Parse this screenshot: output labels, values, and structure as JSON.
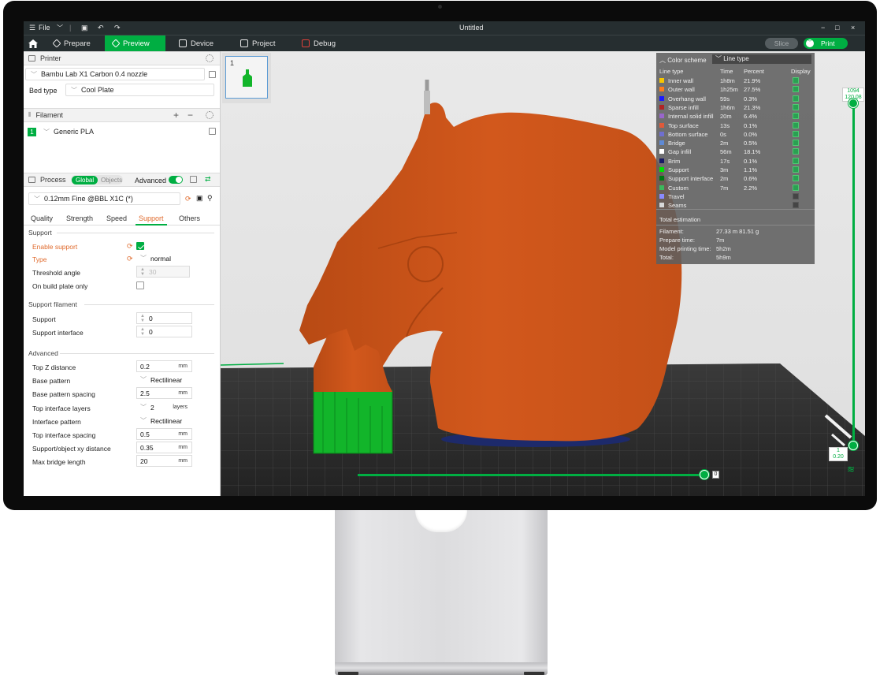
{
  "window": {
    "title": "Untitled",
    "file_menu": "File"
  },
  "tabs": [
    {
      "label": "Prepare"
    },
    {
      "label": "Preview"
    },
    {
      "label": "Device"
    },
    {
      "label": "Project"
    },
    {
      "label": "Debug"
    }
  ],
  "actions": {
    "slice": "Slice",
    "print": "Print"
  },
  "printer": {
    "header": "Printer",
    "preset": "Bambu Lab X1 Carbon 0.4 nozzle",
    "bed_type_label": "Bed type",
    "bed_type": "Cool Plate"
  },
  "filament": {
    "header": "Filament",
    "index": "1",
    "name": "Generic PLA",
    "plus": "+",
    "minus": "−"
  },
  "process": {
    "header": "Process",
    "mode_global": "Global",
    "mode_objects": "Objects",
    "advanced_label": "Advanced",
    "preset": "0.12mm Fine @BBL X1C (*)"
  },
  "subtabs": [
    "Quality",
    "Strength",
    "Speed",
    "Support",
    "Others"
  ],
  "support": {
    "group": "Support",
    "enable_support": "Enable support",
    "type_label": "Type",
    "type_value": "normal",
    "threshold_angle_label": "Threshold angle",
    "threshold_angle_value": "30",
    "build_plate_only": "On build plate only"
  },
  "support_filament": {
    "group": "Support filament",
    "support_label": "Support",
    "support_value": "0",
    "interface_label": "Support interface",
    "interface_value": "0"
  },
  "advanced": {
    "group": "Advanced",
    "rows": [
      {
        "label": "Top Z distance",
        "value": "0.2",
        "unit": "mm"
      },
      {
        "label": "Base pattern",
        "value": "Rectilinear",
        "unit": ""
      },
      {
        "label": "Base pattern spacing",
        "value": "2.5",
        "unit": "mm"
      },
      {
        "label": "Top interface layers",
        "value": "2",
        "unit": "layers"
      },
      {
        "label": "Interface pattern",
        "value": "Rectilinear",
        "unit": ""
      },
      {
        "label": "Top interface spacing",
        "value": "0.5",
        "unit": "mm"
      },
      {
        "label": "Support/object xy distance",
        "value": "0.35",
        "unit": "mm"
      },
      {
        "label": "Max bridge length",
        "value": "20",
        "unit": "mm"
      }
    ]
  },
  "plate": {
    "number": "1"
  },
  "legend": {
    "header": "Color scheme",
    "scheme": "Line type",
    "col_type": "Line type",
    "col_time": "Time",
    "col_percent": "Percent",
    "col_display": "Display",
    "rows": [
      {
        "name": "Inner wall",
        "time": "1h8m",
        "percent": "21.9%",
        "color": "#f7c600",
        "on": true
      },
      {
        "name": "Outer wall",
        "time": "1h25m",
        "percent": "27.5%",
        "color": "#ff7b1a",
        "on": true
      },
      {
        "name": "Overhang wall",
        "time": "59s",
        "percent": "0.3%",
        "color": "#1a1aff",
        "on": true
      },
      {
        "name": "Sparse infill",
        "time": "1h6m",
        "percent": "21.3%",
        "color": "#b02424",
        "on": true
      },
      {
        "name": "Internal solid infill",
        "time": "20m",
        "percent": "6.4%",
        "color": "#9966cc",
        "on": true
      },
      {
        "name": "Top surface",
        "time": "13s",
        "percent": "0.1%",
        "color": "#e05a3a",
        "on": true
      },
      {
        "name": "Bottom surface",
        "time": "0s",
        "percent": "0.0%",
        "color": "#6f6fd0",
        "on": true
      },
      {
        "name": "Bridge",
        "time": "2m",
        "percent": "0.5%",
        "color": "#5e8ad6",
        "on": true
      },
      {
        "name": "Gap infill",
        "time": "56m",
        "percent": "18.1%",
        "color": "#ffffff",
        "on": true
      },
      {
        "name": "Brim",
        "time": "17s",
        "percent": "0.1%",
        "color": "#1a1a66",
        "on": true
      },
      {
        "name": "Support",
        "time": "3m",
        "percent": "1.1%",
        "color": "#00e000",
        "on": true
      },
      {
        "name": "Support interface",
        "time": "2m",
        "percent": "0.6%",
        "color": "#007a14",
        "on": true
      },
      {
        "name": "Custom",
        "time": "7m",
        "percent": "2.2%",
        "color": "#3cb85c",
        "on": true
      },
      {
        "name": "Travel",
        "time": "",
        "percent": "",
        "color": "#8a8aff",
        "on": false
      },
      {
        "name": "Seams",
        "time": "",
        "percent": "",
        "color": "#d8d8d8",
        "on": false
      }
    ],
    "total_header": "Total estimation",
    "stats": [
      {
        "label": "Filament:",
        "value": "27.33 m    81.51 g"
      },
      {
        "label": "Prepare time:",
        "value": "7m"
      },
      {
        "label": "Model printing time:",
        "value": "5h2m"
      },
      {
        "label": "Total:",
        "value": "5h9m"
      }
    ]
  },
  "layer_slider": {
    "top_layer": "1094",
    "top_height": "120.08",
    "bottom_layer": "1",
    "bottom_height": "0.20"
  },
  "move_slider": {
    "value": "0"
  },
  "colors": {
    "accent": "#00ae42",
    "model": "#d2581c",
    "support": "#12b52a",
    "modified": "#e06a2c"
  }
}
